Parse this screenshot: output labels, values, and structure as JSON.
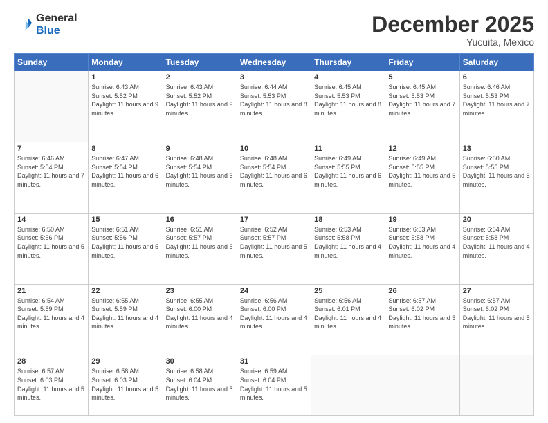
{
  "header": {
    "logo_general": "General",
    "logo_blue": "Blue",
    "title": "December 2025",
    "subtitle": "Yucuita, Mexico"
  },
  "weekdays": [
    "Sunday",
    "Monday",
    "Tuesday",
    "Wednesday",
    "Thursday",
    "Friday",
    "Saturday"
  ],
  "weeks": [
    [
      {
        "day": "",
        "info": ""
      },
      {
        "day": "1",
        "info": "Sunrise: 6:43 AM\nSunset: 5:52 PM\nDaylight: 11 hours\nand 9 minutes."
      },
      {
        "day": "2",
        "info": "Sunrise: 6:43 AM\nSunset: 5:52 PM\nDaylight: 11 hours\nand 9 minutes."
      },
      {
        "day": "3",
        "info": "Sunrise: 6:44 AM\nSunset: 5:53 PM\nDaylight: 11 hours\nand 8 minutes."
      },
      {
        "day": "4",
        "info": "Sunrise: 6:45 AM\nSunset: 5:53 PM\nDaylight: 11 hours\nand 8 minutes."
      },
      {
        "day": "5",
        "info": "Sunrise: 6:45 AM\nSunset: 5:53 PM\nDaylight: 11 hours\nand 7 minutes."
      },
      {
        "day": "6",
        "info": "Sunrise: 6:46 AM\nSunset: 5:53 PM\nDaylight: 11 hours\nand 7 minutes."
      }
    ],
    [
      {
        "day": "7",
        "info": "Sunrise: 6:46 AM\nSunset: 5:54 PM\nDaylight: 11 hours\nand 7 minutes."
      },
      {
        "day": "8",
        "info": "Sunrise: 6:47 AM\nSunset: 5:54 PM\nDaylight: 11 hours\nand 6 minutes."
      },
      {
        "day": "9",
        "info": "Sunrise: 6:48 AM\nSunset: 5:54 PM\nDaylight: 11 hours\nand 6 minutes."
      },
      {
        "day": "10",
        "info": "Sunrise: 6:48 AM\nSunset: 5:54 PM\nDaylight: 11 hours\nand 6 minutes."
      },
      {
        "day": "11",
        "info": "Sunrise: 6:49 AM\nSunset: 5:55 PM\nDaylight: 11 hours\nand 6 minutes."
      },
      {
        "day": "12",
        "info": "Sunrise: 6:49 AM\nSunset: 5:55 PM\nDaylight: 11 hours\nand 5 minutes."
      },
      {
        "day": "13",
        "info": "Sunrise: 6:50 AM\nSunset: 5:55 PM\nDaylight: 11 hours\nand 5 minutes."
      }
    ],
    [
      {
        "day": "14",
        "info": "Sunrise: 6:50 AM\nSunset: 5:56 PM\nDaylight: 11 hours\nand 5 minutes."
      },
      {
        "day": "15",
        "info": "Sunrise: 6:51 AM\nSunset: 5:56 PM\nDaylight: 11 hours\nand 5 minutes."
      },
      {
        "day": "16",
        "info": "Sunrise: 6:51 AM\nSunset: 5:57 PM\nDaylight: 11 hours\nand 5 minutes."
      },
      {
        "day": "17",
        "info": "Sunrise: 6:52 AM\nSunset: 5:57 PM\nDaylight: 11 hours\nand 5 minutes."
      },
      {
        "day": "18",
        "info": "Sunrise: 6:53 AM\nSunset: 5:58 PM\nDaylight: 11 hours\nand 4 minutes."
      },
      {
        "day": "19",
        "info": "Sunrise: 6:53 AM\nSunset: 5:58 PM\nDaylight: 11 hours\nand 4 minutes."
      },
      {
        "day": "20",
        "info": "Sunrise: 6:54 AM\nSunset: 5:58 PM\nDaylight: 11 hours\nand 4 minutes."
      }
    ],
    [
      {
        "day": "21",
        "info": "Sunrise: 6:54 AM\nSunset: 5:59 PM\nDaylight: 11 hours\nand 4 minutes."
      },
      {
        "day": "22",
        "info": "Sunrise: 6:55 AM\nSunset: 5:59 PM\nDaylight: 11 hours\nand 4 minutes."
      },
      {
        "day": "23",
        "info": "Sunrise: 6:55 AM\nSunset: 6:00 PM\nDaylight: 11 hours\nand 4 minutes."
      },
      {
        "day": "24",
        "info": "Sunrise: 6:56 AM\nSunset: 6:00 PM\nDaylight: 11 hours\nand 4 minutes."
      },
      {
        "day": "25",
        "info": "Sunrise: 6:56 AM\nSunset: 6:01 PM\nDaylight: 11 hours\nand 4 minutes."
      },
      {
        "day": "26",
        "info": "Sunrise: 6:57 AM\nSunset: 6:02 PM\nDaylight: 11 hours\nand 5 minutes."
      },
      {
        "day": "27",
        "info": "Sunrise: 6:57 AM\nSunset: 6:02 PM\nDaylight: 11 hours\nand 5 minutes."
      }
    ],
    [
      {
        "day": "28",
        "info": "Sunrise: 6:57 AM\nSunset: 6:03 PM\nDaylight: 11 hours\nand 5 minutes."
      },
      {
        "day": "29",
        "info": "Sunrise: 6:58 AM\nSunset: 6:03 PM\nDaylight: 11 hours\nand 5 minutes."
      },
      {
        "day": "30",
        "info": "Sunrise: 6:58 AM\nSunset: 6:04 PM\nDaylight: 11 hours\nand 5 minutes."
      },
      {
        "day": "31",
        "info": "Sunrise: 6:59 AM\nSunset: 6:04 PM\nDaylight: 11 hours\nand 5 minutes."
      },
      {
        "day": "",
        "info": ""
      },
      {
        "day": "",
        "info": ""
      },
      {
        "day": "",
        "info": ""
      }
    ]
  ]
}
